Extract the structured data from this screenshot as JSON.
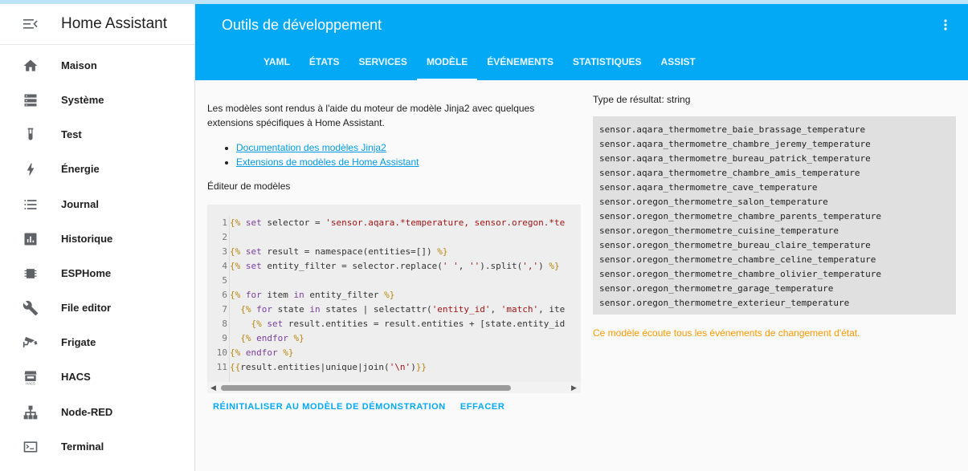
{
  "sidebar": {
    "title": "Home Assistant",
    "items": [
      {
        "label": "Maison",
        "icon": "home-icon"
      },
      {
        "label": "Système",
        "icon": "server-icon"
      },
      {
        "label": "Test",
        "icon": "test-tube-icon"
      },
      {
        "label": "Énergie",
        "icon": "lightning-icon"
      },
      {
        "label": "Journal",
        "icon": "list-icon"
      },
      {
        "label": "Historique",
        "icon": "chart-box-icon"
      },
      {
        "label": "ESPHome",
        "icon": "chip-icon"
      },
      {
        "label": "File editor",
        "icon": "wrench-icon"
      },
      {
        "label": "Frigate",
        "icon": "cctv-icon"
      },
      {
        "label": "HACS",
        "icon": "hacs-store-icon"
      },
      {
        "label": "Node-RED",
        "icon": "sitemap-icon"
      },
      {
        "label": "Terminal",
        "icon": "console-icon"
      }
    ]
  },
  "header": {
    "title": "Outils de développement",
    "tabs": [
      {
        "label": "YAML",
        "active": false
      },
      {
        "label": "ÉTATS",
        "active": false
      },
      {
        "label": "SERVICES",
        "active": false
      },
      {
        "label": "MODÈLE",
        "active": true
      },
      {
        "label": "ÉVÉNEMENTS",
        "active": false
      },
      {
        "label": "STATISTIQUES",
        "active": false
      },
      {
        "label": "ASSIST",
        "active": false
      }
    ]
  },
  "template": {
    "intro": "Les modèles sont rendus à l'aide du moteur de modèle Jinja2 avec quelques extensions spécifiques à Home Assistant.",
    "links": [
      "Documentation des modèles Jinja2",
      "Extensions de modèles de Home Assistant"
    ],
    "editor_title": "Éditeur de modèles",
    "code_lines": [
      "{% set selector = 'sensor.aqara.*temperature, sensor.oregon.*te",
      "",
      "{% set result = namespace(entities=[]) %}",
      "{% set entity_filter = selector.replace(' ', '').split(',') %}",
      "",
      "{% for item in entity_filter %}",
      "  {% for state in states | selectattr('entity_id', 'match', ite",
      "    {% set result.entities = result.entities + [state.entity_id",
      "  {% endfor %}",
      "{% endfor %}",
      "{{result.entities|unique|join('\\n')}}"
    ],
    "reset_button": "RÉINITIALISER AU MODÈLE DE DÉMONSTRATION",
    "clear_button": "EFFACER"
  },
  "result": {
    "type_label": "Type de résultat: string",
    "lines": [
      "sensor.aqara_thermometre_baie_brassage_temperature",
      "sensor.aqara_thermometre_chambre_jeremy_temperature",
      "sensor.aqara_thermometre_bureau_patrick_temperature",
      "sensor.aqara_thermometre_chambre_amis_temperature",
      "sensor.aqara_thermometre_cave_temperature",
      "sensor.oregon_thermometre_salon_temperature",
      "sensor.oregon_thermometre_chambre_parents_temperature",
      "sensor.oregon_thermometre_cuisine_temperature",
      "sensor.oregon_thermometre_bureau_claire_temperature",
      "sensor.oregon_thermometre_chambre_celine_temperature",
      "sensor.oregon_thermometre_chambre_olivier_temperature",
      "sensor.oregon_thermometre_garage_temperature",
      "sensor.oregon_thermometre_exterieur_temperature"
    ],
    "listen_text": "Ce modèle écoute tous les événements de changement d'état."
  },
  "colors": {
    "header": "#03a9f4",
    "accent": "#03a9f4",
    "warning": "#ff9800"
  }
}
